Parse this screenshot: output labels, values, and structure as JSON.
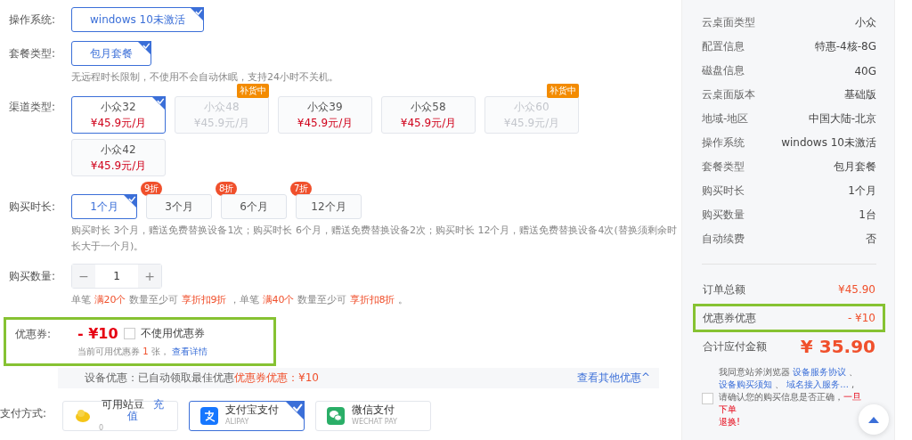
{
  "os": {
    "label": "操作系统:",
    "options": [
      {
        "text": "windows 10未激活",
        "selected": true
      }
    ]
  },
  "plan": {
    "label": "套餐类型:",
    "options": [
      {
        "text": "包月套餐",
        "selected": true
      }
    ],
    "note": "无远程时长限制，不使用不会自动休眠，支持24小时不关机。"
  },
  "channels": {
    "label": "渠道类型:",
    "items": [
      {
        "name": "小众32",
        "price": "¥45.9元/月",
        "disabled": false,
        "selected": true
      },
      {
        "name": "小众48",
        "price": "¥45.9元/月",
        "disabled": true,
        "badge": "补货中",
        "selected": false
      },
      {
        "name": "小众39",
        "price": "¥45.9元/月",
        "disabled": false,
        "selected": false
      },
      {
        "name": "小众58",
        "price": "¥45.9元/月",
        "disabled": false,
        "selected": false
      },
      {
        "name": "小众60",
        "price": "¥45.9元/月",
        "disabled": true,
        "badge": "补货中",
        "selected": false
      },
      {
        "name": "小众42",
        "price": "¥45.9元/月",
        "disabled": false,
        "selected": false
      }
    ]
  },
  "duration": {
    "label": "购买时长:",
    "options": [
      {
        "text": "1个月",
        "selected": true
      },
      {
        "text": "3个月",
        "badge": "9折",
        "selected": false
      },
      {
        "text": "6个月",
        "badge": "8折",
        "selected": false
      },
      {
        "text": "12个月",
        "badge": "7折",
        "selected": false
      }
    ],
    "note": "购买时长 3个月，赠送免费替换设备1次；购买时长 6个月，赠送免费替换设备2次；购买时长 12个月，赠送免费替换设备4次(替换须剩余时长大于一个月)。"
  },
  "quantity": {
    "label": "购买数量:",
    "minus": "−",
    "value": "1",
    "plus": "+",
    "note": [
      {
        "text": "单笔 ",
        "highlight": false
      },
      {
        "text": "满20个",
        "highlight": true
      },
      {
        "text": " 数量至少可 ",
        "highlight": false
      },
      {
        "text": "享折扣9折",
        "highlight": true
      },
      {
        "text": " ，单笔 ",
        "highlight": false
      },
      {
        "text": "满40个",
        "highlight": true
      },
      {
        "text": " 数量至少可 ",
        "highlight": false
      },
      {
        "text": "享折扣8折",
        "highlight": true
      },
      {
        "text": " 。",
        "highlight": false
      }
    ]
  },
  "coupon": {
    "label": "优惠券:",
    "amount": "- ¥10",
    "highlighted": true,
    "checkbox": {
      "label": "不使用优惠券",
      "checked": false
    },
    "note": "当前可用优惠券",
    "count": "1",
    "unit": "张，",
    "link": "查看详情"
  },
  "device_discount": {
    "label": "设备优惠：",
    "text": "已自动领取最佳优惠",
    "highlight": "优惠券优惠：¥10",
    "link": "查看其他优惠^"
  },
  "payment": {
    "label": "支付方式:",
    "methods": [
      {
        "kind": "balance",
        "name": "可用站豆",
        "action": "充值",
        "sub": "0",
        "selected": false
      },
      {
        "kind": "alipay",
        "name": "支付宝支付",
        "sub": "ALIPAY",
        "selected": true
      },
      {
        "kind": "wechat",
        "name": "微信支付",
        "sub": "WECHAT PAY",
        "selected": false
      }
    ]
  },
  "summary": {
    "items": [
      {
        "label": "云桌面类型",
        "value": "小众"
      },
      {
        "label": "配置信息",
        "value": "特惠-4核-8G"
      },
      {
        "label": "磁盘信息",
        "value": "40G"
      },
      {
        "label": "云桌面版本",
        "value": "基础版"
      },
      {
        "label": "地域-地区",
        "value": "中国大陆-北京"
      },
      {
        "label": "操作系统",
        "value": "windows 10未激活"
      },
      {
        "label": "套餐类型",
        "value": "包月套餐"
      },
      {
        "label": "购买时长",
        "value": "1个月"
      },
      {
        "label": "购买数量",
        "value": "1台"
      },
      {
        "label": "自动续费",
        "value": "否"
      }
    ],
    "totals": [
      {
        "kind": "normal",
        "label": "订单总额",
        "value": "¥45.90",
        "highlighted": false
      },
      {
        "kind": "normal",
        "label": "优惠券优惠",
        "value": "- ¥10",
        "highlighted": true
      },
      {
        "kind": "grand",
        "label": "合计应付金额",
        "value": "¥ 35.90",
        "highlighted": false
      }
    ],
    "agreement": {
      "checked": false,
      "parts": [
        {
          "kind": "text",
          "text": "我同意站斧浏览器 "
        },
        {
          "kind": "link",
          "text": "设备服务协议"
        },
        {
          "kind": "text",
          "text": " 、 "
        },
        {
          "kind": "link",
          "text": "设备购买须知"
        },
        {
          "kind": "text",
          "text": " 、 "
        },
        {
          "kind": "link",
          "text": "域名接入服务..."
        },
        {
          "kind": "text",
          "text": " ,请确认您的购买信息是否正确，"
        },
        {
          "kind": "warn",
          "text": "一旦下单"
        },
        {
          "kind": "warnline",
          "text": "退换!"
        }
      ]
    }
  }
}
